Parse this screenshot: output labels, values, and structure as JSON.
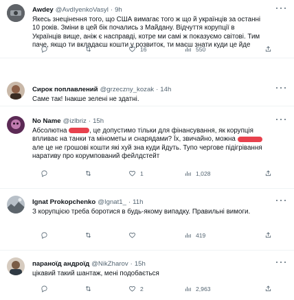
{
  "tweets": [
    {
      "name": "Awdey",
      "handle": "@AvdIyenkoVasyl",
      "time": "9h",
      "lines": [
        "Якесь знецінення того, що США вимагає того ж що й українців за останні",
        "10 років. Зміни в цей бік почались з Майдану. Відчуття корупції в",
        "Українців вище, аніж є насправді, котре ми самі ж показуємо світові. Тим",
        "паче, якщо ти вкладаєш кошти у розвиток, ти маєш знати куди це йде"
      ],
      "likes": "16",
      "views": "550",
      "avatar_color": "#6a6a6a"
    },
    {
      "name": "Сирок поплавлений",
      "handle": "@grzeczny_kozak",
      "time": "14h",
      "lines": [
        "Саме так! Інакше зелені не здатні."
      ],
      "likes": "",
      "views": "23",
      "avatar_color": "#4a3326"
    },
    {
      "name": "No Name",
      "handle": "@izlbriz",
      "time": "15h",
      "line1_a": "Абсолютна ",
      "line1_b": ", це допустимо тільки для фінансування, як корупція",
      "line2": "впливає на танки та мінометы и снарядами? Їх, звичайно, можна",
      "line3": "але це не грошові кошти які хуй зна куди йдуть. Тупо чергове підігрівання",
      "line4": "наративу про корумпований фейлдстейт",
      "likes": "1",
      "views": "1,028",
      "avatar_color": "#7a2f6a"
    },
    {
      "name": "Ignat Prokopchenko",
      "handle": "@Ignat1_",
      "time": "11h",
      "lines": [
        "З корупцією треба боротися в будь-якому випадку. Правильні вимоги."
      ],
      "likes": "",
      "views": "419",
      "avatar_color": "#8a8f94"
    },
    {
      "name": "параноїд андроїд",
      "handle": "@NikZharov",
      "time": "15h",
      "lines": [
        "цікавий такий шантаж, мені подобається"
      ],
      "likes": "2",
      "views": "2,963",
      "avatar_color": "#7c6a5a"
    }
  ],
  "separator": "·"
}
